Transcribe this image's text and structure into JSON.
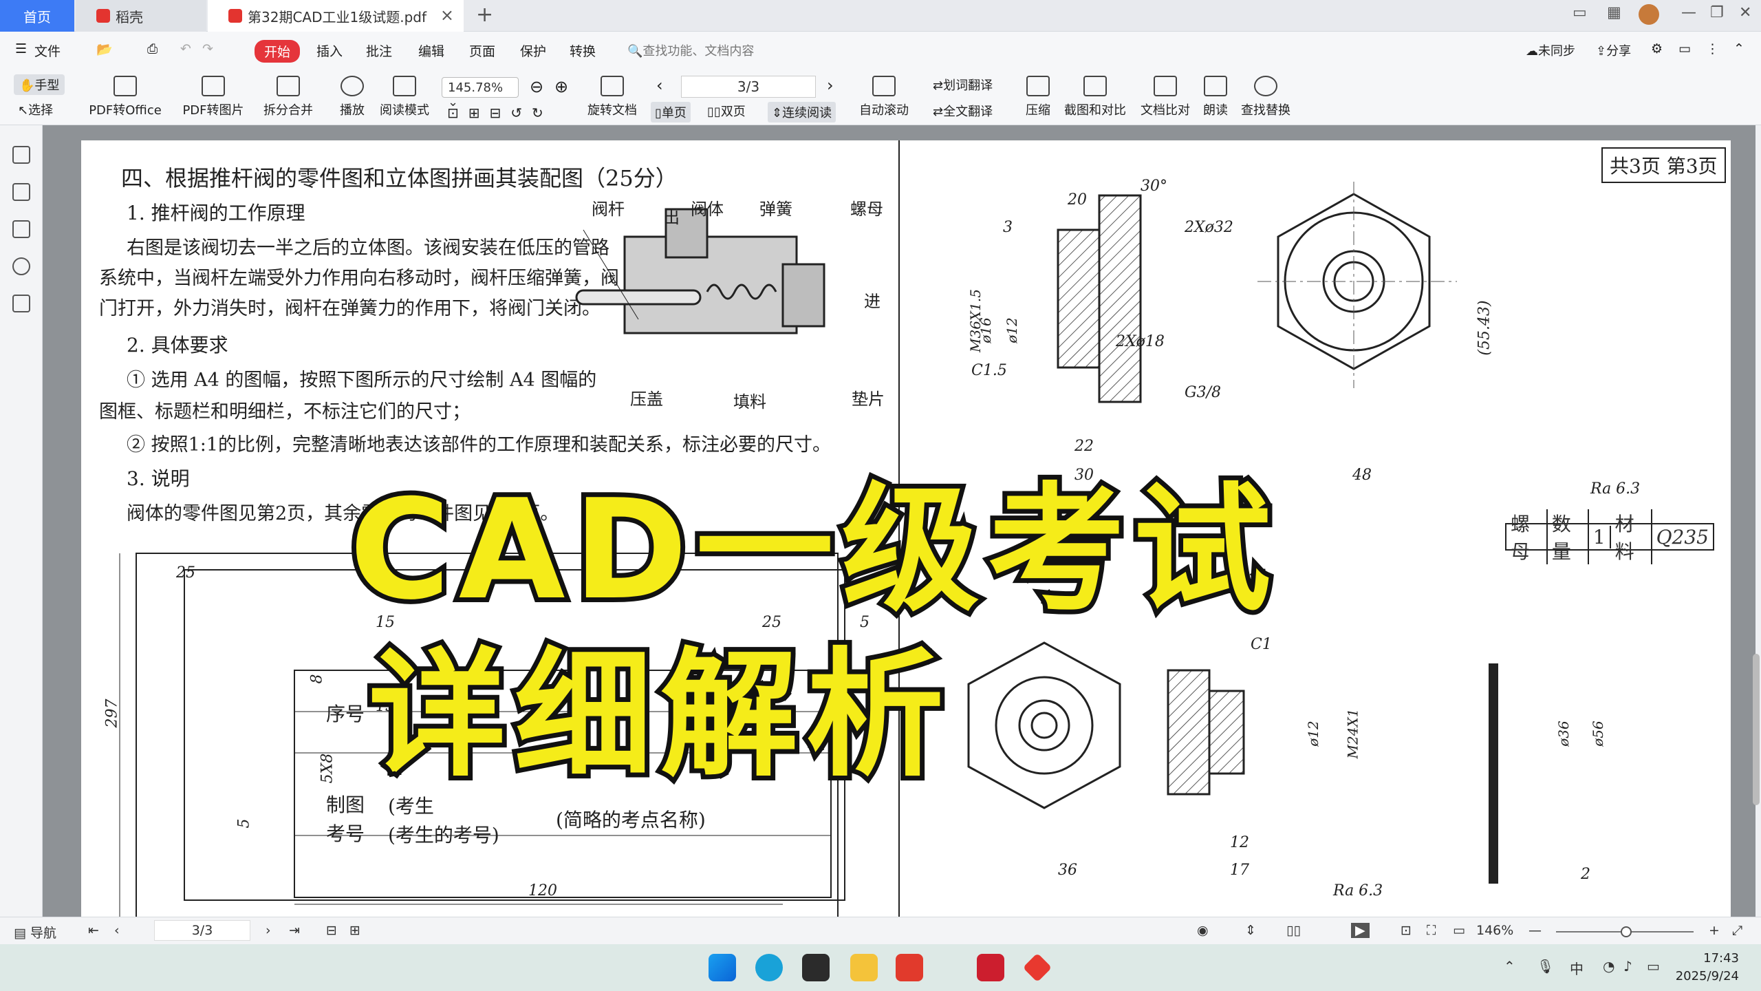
{
  "tabs": {
    "home": "首页",
    "daoke": "稻壳",
    "pdf": "第32期CAD工业1级试题.pdf"
  },
  "menu": {
    "file": "文件",
    "start": "开始",
    "insert": "插入",
    "annotate": "批注",
    "edit": "编辑",
    "page": "页面",
    "protect": "保护",
    "convert": "转换",
    "search_placeholder": "查找功能、文档内容",
    "sync": "未同步",
    "share": "分享"
  },
  "ribbon": {
    "hand": "手型",
    "select": "选择",
    "pdf_to_office": "PDF转Office",
    "pdf_to_image": "PDF转图片",
    "split_merge": "拆分合并",
    "play": "播放",
    "read_mode": "阅读模式",
    "zoom": "145.78%",
    "page": "3/3",
    "rotate": "旋转文档",
    "single": "单页",
    "double": "双页",
    "continuous": "连续阅读",
    "auto_scroll": "自动滚动",
    "word_translate": "划词翻译",
    "full_translate": "全文翻译",
    "compress": "压缩",
    "screenshot_compare": "截图和对比",
    "doc_compare": "文档比对",
    "read_aloud": "朗读",
    "find_replace": "查找替换"
  },
  "document": {
    "heading": "四、根据推杆阀的零件图和立体图拼画其装配图（25分）",
    "s1": "1. 推杆阀的工作原理",
    "p1a": "右图是该阀切去一半之后的立体图。该阀安装在低压的管路",
    "p1b": "系统中，当阀杆左端受外力作用向右移动时，阀杆压缩弹簧，阀",
    "p1c": "门打开，外力消失时，阀杆在弹簧力的作用下，将阀门关闭。",
    "s2": "2. 具体要求",
    "r1a": "① 选用 A4 的图幅，按照下图所示的尺寸绘制 A4 图幅的",
    "r1b": "图框、标题栏和明细栏，不标注它们的尺寸；",
    "r2": "② 按照1:1的比例，完整清晰地表达该部件的工作原理和装配关系，标注必要的尺寸。",
    "s3": "3. 说明",
    "note": "阀体的零件图见第2页，其余零件的零件图见第3页。",
    "labels": {
      "rod": "阀杆",
      "out": "出",
      "body": "阀体",
      "spring": "弹簧",
      "nut": "螺母",
      "in": "进",
      "gland": "压盖",
      "packing": "填料",
      "gasket": "垫片"
    },
    "page_stamp": "共3页 第3页",
    "dims": {
      "d20": "20",
      "d30deg": "30°",
      "d3": "3",
      "d2x32": "2Xø32",
      "m36": "M36X1.5",
      "d16": "ø16",
      "d12": "ø12",
      "d2x18": "2Xø18",
      "c15": "C1.5",
      "g38": "G3/8",
      "d22": "22",
      "d30": "30",
      "d48": "48",
      "d5543": "(55.43)",
      "ra": "Ra 6.3",
      "d25": "25",
      "d297": "297",
      "d15": "15",
      "d8": "8",
      "d5x8": "5X8",
      "d5": "5",
      "d120": "120",
      "d36": "36",
      "d12b": "12",
      "d17": "17",
      "m24": "M24X1",
      "d12c": "ø12",
      "d36b": "ø36",
      "d56": "ø56",
      "d2": "2",
      "c1": "C1"
    },
    "title_table": {
      "nut": "螺母",
      "qty": "数量",
      "one": "1",
      "material": "材料",
      "q235": "Q235"
    },
    "block": {
      "seq": "序号",
      "draw": "制图",
      "examno": "考号",
      "examno_val": "(考生的考号)",
      "student": "(考生",
      "site": "(简略的考点名称)"
    }
  },
  "overlay": {
    "line1": "CAD一级考试",
    "line2": "详细解析"
  },
  "status": {
    "nav": "导航",
    "page": "3/3",
    "zoom": "146%"
  },
  "taskbar": {
    "time": "17:43",
    "date": "2025/9/24",
    "ime": "中"
  }
}
